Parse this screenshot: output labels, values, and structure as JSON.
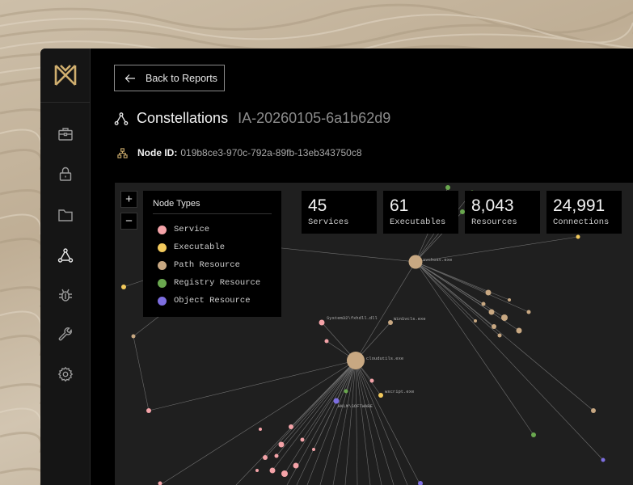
{
  "toolbar": {
    "back_label": "Back to Reports"
  },
  "header": {
    "title": "Constellations",
    "report_id": "IA-20260105-6a1b62d9"
  },
  "node": {
    "label": "Node ID:",
    "id": "019b8ce3-970c-792a-89fb-13eb343750c8"
  },
  "sidebar": {
    "items": [
      {
        "icon": "briefcase-icon"
      },
      {
        "icon": "lock-icon"
      },
      {
        "icon": "folder-icon"
      },
      {
        "icon": "constellation-icon",
        "active": true
      },
      {
        "icon": "bug-icon"
      },
      {
        "icon": "wrench-icon"
      },
      {
        "icon": "gear-icon"
      }
    ]
  },
  "legend": {
    "title": "Node Types",
    "items": [
      {
        "label": "Service",
        "color": "#f4a3a8"
      },
      {
        "label": "Executable",
        "color": "#f2c95c"
      },
      {
        "label": "Path Resource",
        "color": "#c8a882"
      },
      {
        "label": "Registry Resource",
        "color": "#6aa84f"
      },
      {
        "label": "Object Resource",
        "color": "#7d6ee0"
      }
    ]
  },
  "stats": [
    {
      "value": "45",
      "label": "Services"
    },
    {
      "value": "61",
      "label": "Executables"
    },
    {
      "value": "8,043",
      "label": "Resources"
    },
    {
      "value": "24,991",
      "label": "Connections"
    }
  ],
  "zoom": {
    "in_label": "+",
    "out_label": "−"
  },
  "graph_labels": {
    "hub1": "cloudutils.exe",
    "hub2": "svchost.exe",
    "n1": "System32\\fxhdll.dll",
    "n2": "WinSvcls.exe",
    "n3": "wscript.exe",
    "n4": "HKLM\\SOFTWARE"
  }
}
